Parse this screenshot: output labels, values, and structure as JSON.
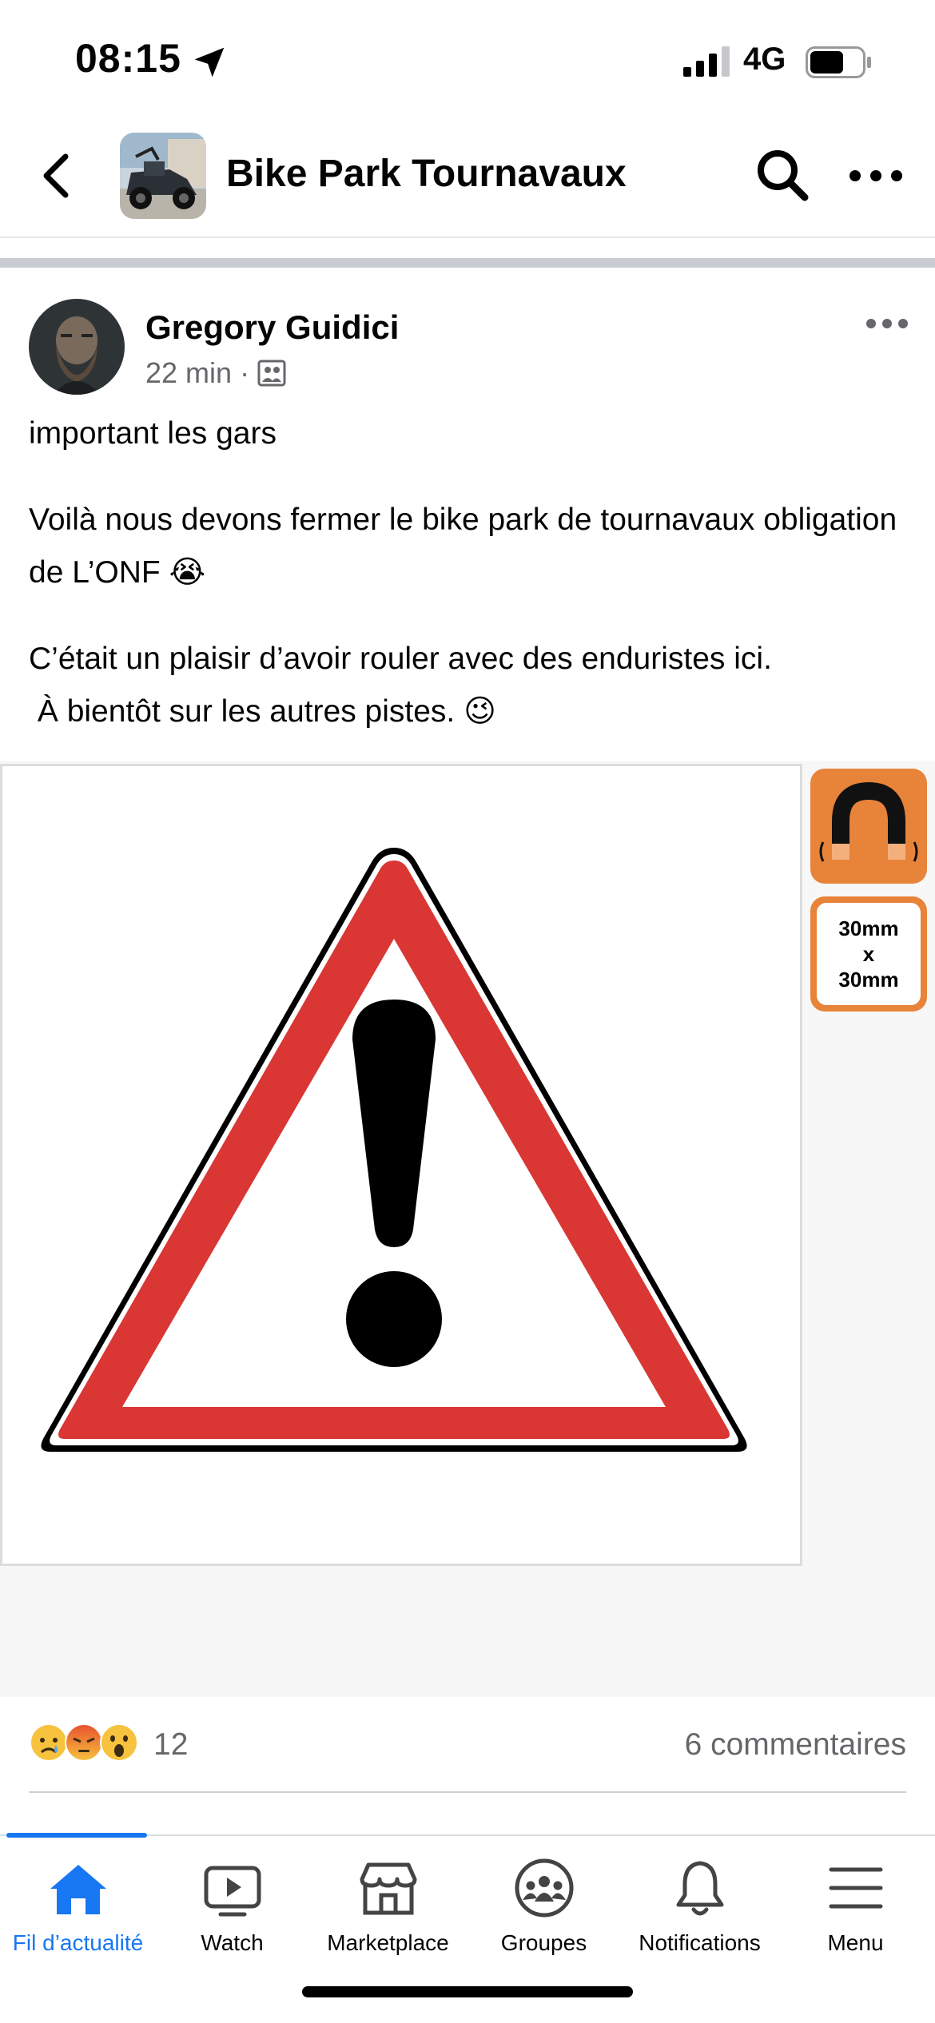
{
  "status_bar": {
    "time": "08:15",
    "network": "4G",
    "battery_level": 0.65
  },
  "header": {
    "title": "Bike Park Tournavaux"
  },
  "post": {
    "author": "Gregory Guidici",
    "time": "22 min",
    "separator": "·",
    "paragraphs": [
      "important les gars",
      "Voilà nous devons fermer le bike park de tournavaux obligation de L’ONF 😭",
      "C’était un plaisir d’avoir rouler avec des enduristes ici.\n À bientôt sur les autres pistes. 😉"
    ],
    "image": {
      "badge_size_line1": "30mm",
      "badge_size_line2": "x",
      "badge_size_line3": "30mm"
    },
    "reactions": {
      "icons": [
        "sad-reaction-icon",
        "angry-reaction-icon",
        "wow-reaction-icon"
      ],
      "count": "12",
      "comments": "6 commentaires"
    }
  },
  "tab_bar": {
    "tabs": [
      {
        "label": "Fil d’actualité",
        "icon": "home-icon",
        "active": true
      },
      {
        "label": "Watch",
        "icon": "watch-icon",
        "active": false
      },
      {
        "label": "Marketplace",
        "icon": "marketplace-icon",
        "active": false
      },
      {
        "label": "Groupes",
        "icon": "groups-icon",
        "active": false
      },
      {
        "label": "Notifications",
        "icon": "bell-icon",
        "active": false
      },
      {
        "label": "Menu",
        "icon": "menu-icon",
        "active": false
      }
    ]
  },
  "colors": {
    "accent": "#1877f2",
    "secondary_text": "#65676b",
    "warning_red": "#d93634",
    "badge_orange": "#e8833a"
  }
}
